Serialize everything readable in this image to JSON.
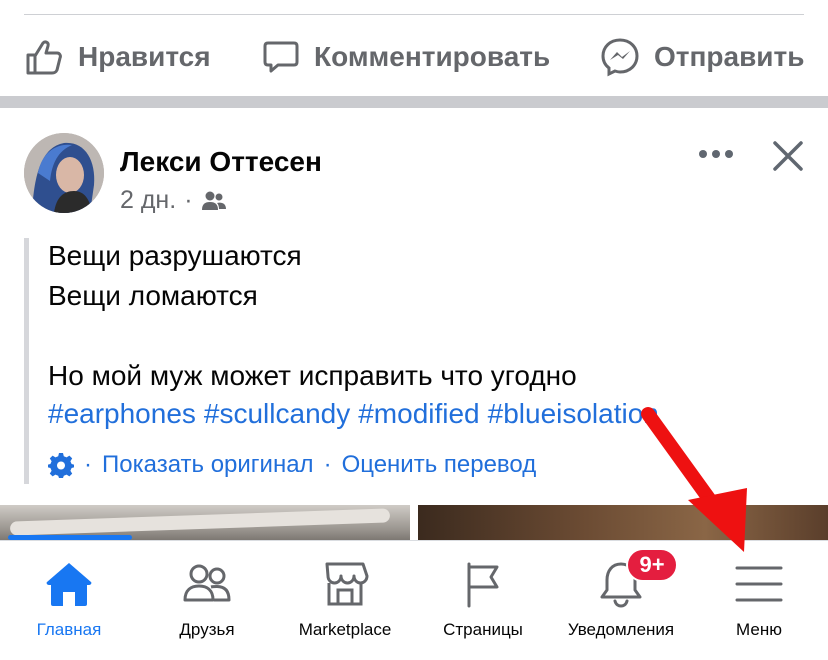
{
  "actions": {
    "like_label": "Нравится",
    "comment_label": "Комментировать",
    "share_label": "Отправить"
  },
  "post": {
    "author": "Лекси Оттесен",
    "time": "2 дн.",
    "separator": "·",
    "audience_icon": "friends-icon",
    "text_lines": [
      "Вещи разрушаются",
      "Вещи ломаются",
      "",
      "Но мой муж может исправить что угодно"
    ],
    "hashtags": [
      "#earphones",
      "#scullcandy",
      "#modified",
      "#blueisolation"
    ],
    "translation": {
      "show_original": "Показать оригинал",
      "rate_translation": "Оценить перевод"
    }
  },
  "tabbar": {
    "tabs": [
      {
        "label": "Главная",
        "icon": "home-icon",
        "active": true
      },
      {
        "label": "Друзья",
        "icon": "friends-icon"
      },
      {
        "label": "Marketplace",
        "icon": "marketplace-icon"
      },
      {
        "label": "Страницы",
        "icon": "pages-flag-icon"
      },
      {
        "label": "Уведомления",
        "icon": "bell-icon"
      },
      {
        "label": "Меню",
        "icon": "hamburger-menu-icon"
      }
    ],
    "notification_badge": "9+"
  },
  "colors": {
    "accent": "#1877f2",
    "link": "#216fdb",
    "secondary_text": "#65676b",
    "badge": "#e41e3f",
    "annotation_arrow": "#ee1111"
  }
}
